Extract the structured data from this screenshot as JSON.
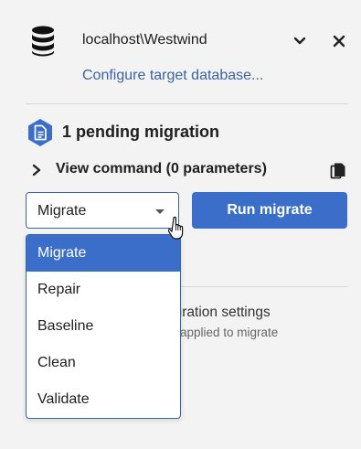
{
  "connection": {
    "name": "localhost\\Westwind",
    "configure_link": "Configure target database..."
  },
  "migration": {
    "pending_title": "1 pending migration",
    "view_command": "View command (0 parameters)"
  },
  "command_select": {
    "selected": "Migrate",
    "options": [
      "Migrate",
      "Repair",
      "Baseline",
      "Clean",
      "Validate"
    ]
  },
  "run_button": {
    "label": "Run migrate"
  },
  "settings_section": {
    "title_fragment": "guration settings",
    "subtitle_fragment": "applied to migrate"
  },
  "colors": {
    "accent": "#3a6ec9",
    "link": "#3a63a8",
    "background": "#f3f3f3"
  }
}
